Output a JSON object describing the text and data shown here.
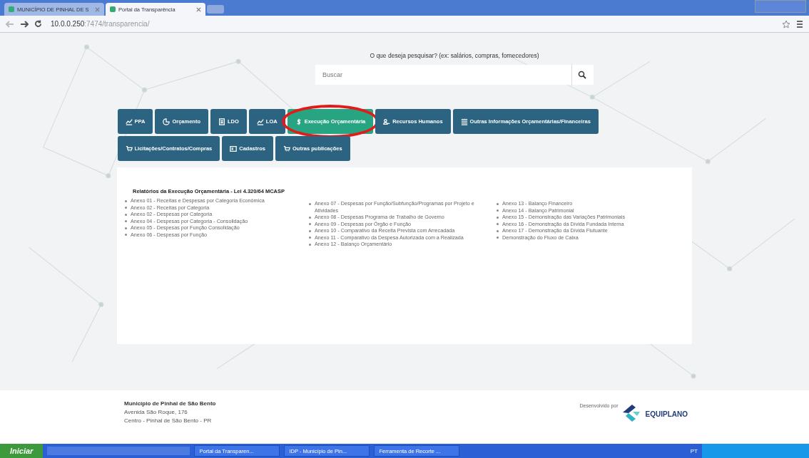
{
  "browser": {
    "tabs": [
      {
        "label": "MUNICÍPIO DE PINHAL DE S",
        "selected": false
      },
      {
        "label": "Portal da Transparência",
        "selected": true
      }
    ],
    "url_host": "10.0.0.250",
    "url_path": ":7474/transparencia/"
  },
  "search": {
    "label": "O que deseja pesquisar? (ex: salários, compras, fornecedores)",
    "placeholder": "Buscar"
  },
  "nav": [
    {
      "label": "PPA",
      "kind": "chart",
      "selected": false,
      "circled": false
    },
    {
      "label": "Orçamento",
      "kind": "pie",
      "selected": false,
      "circled": false
    },
    {
      "label": "LDO",
      "kind": "doc",
      "selected": false,
      "circled": false
    },
    {
      "label": "LOA",
      "kind": "chart",
      "selected": false,
      "circled": false
    },
    {
      "label": "Execução Orçamentária",
      "kind": "money",
      "selected": true,
      "circled": true
    },
    {
      "label": "Recursos Humanos",
      "kind": "users",
      "selected": false,
      "circled": false
    },
    {
      "label": "Outras Informações Orçamentárias/Financeiras",
      "kind": "list",
      "selected": false,
      "circled": false
    },
    {
      "label": "Licitações/Contratos/Compras",
      "kind": "cart",
      "selected": false,
      "circled": false
    },
    {
      "label": "Cadastros",
      "kind": "card",
      "selected": false,
      "circled": false
    },
    {
      "label": "Outras publicações",
      "kind": "cart",
      "selected": false,
      "circled": false
    }
  ],
  "reports": {
    "title": "Relatórios da Execução Orçamentária - Lei 4.320/64 MCASP",
    "columns": [
      [
        "Anexo 01 - Receitas e Despesas por Categoria Econômica",
        "Anexo 02 - Receitas por Categoria",
        "Anexo 02 - Despesas por Categoria",
        "Anexo 04 - Despesas por Categoria - Consolidação",
        "Anexo 05 - Despesas por Função Consolidação",
        "Anexo 06 - Despesas por Função"
      ],
      [
        "Anexo 07 - Despesas por Função/Subfunção/Programas por Projeto e Atividades",
        "Anexo 08 - Despesas Programa de Trabalho de Governo",
        "Anexo 09 - Despesas por Órgão e Função",
        "Anexo 10 - Comparativo da Receita Prevista com Arrecadada",
        "Anexo 11 - Comparativo da Despesa Autorizada com a Realizada",
        "Anexo 12 - Balanço Orçamentário"
      ],
      [
        "Anexo 13 - Balanço Financeiro",
        "Anexo 14 - Balanço Patrimonial",
        "Anexo 15 - Demonstração das Variações Patrimoniais",
        "Anexo 16 - Demonstração da Dívida Fundada Interna",
        "Anexo 17 - Demonstração da Dívida Flutuante",
        "Demonstração do Fluxo de Caixa"
      ]
    ]
  },
  "footer": {
    "lines": [
      "Município de Pinhal de São Bento",
      "Avenida São Roque, 176",
      "Centro - Pinhal de São Bento - PR"
    ],
    "credit": "Desenvolvido por",
    "brand": "EQUIPLANO"
  },
  "taskbar": {
    "start": "Iniciar",
    "tasks": [
      "Portal da Transparen...",
      "IDP - Município de Pin...",
      "Ferramenta de Recorte ..."
    ],
    "lang": "PT"
  }
}
